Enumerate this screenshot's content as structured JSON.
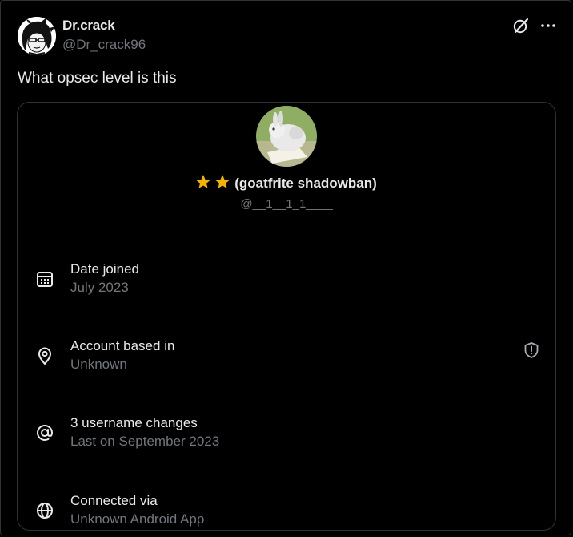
{
  "post": {
    "author_name": "Dr.crack",
    "author_handle": "@Dr_crack96",
    "text": "What opsec level is this"
  },
  "card": {
    "display_name": "(goatfrite shadowban)",
    "handle": "@__1__1_1____",
    "rows": [
      {
        "icon": "calendar-icon",
        "title": "Date joined",
        "subtitle": "July 2023"
      },
      {
        "icon": "location-pin-icon",
        "title": "Account based in",
        "subtitle": "Unknown"
      },
      {
        "icon": "at-sign-icon",
        "title": "3 username changes",
        "subtitle": "Last on September 2023"
      },
      {
        "icon": "globe-icon",
        "title": "Connected via",
        "subtitle": "Unknown Android App"
      }
    ]
  },
  "colors": {
    "background": "#000000",
    "primary_text": "#e7e9ea",
    "secondary_text": "#71767b",
    "border": "#2f3336",
    "star": "#f4b400"
  }
}
